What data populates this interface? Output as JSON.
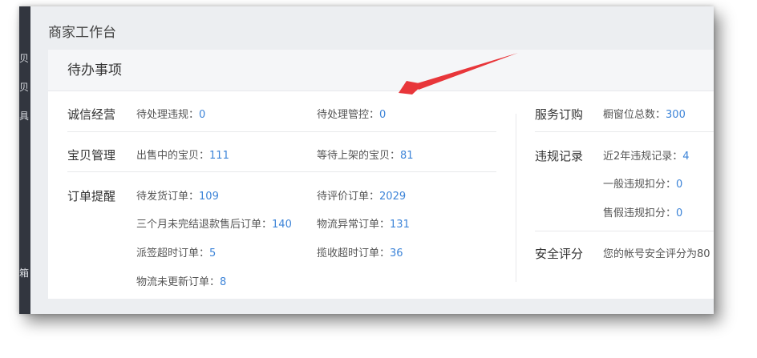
{
  "page_title": "商家工作台",
  "side_fragments": [
    "贝",
    "贝",
    "具",
    "箱"
  ],
  "panel": {
    "title": "待办事项"
  },
  "sep": "：",
  "integrity": {
    "label": "诚信经营",
    "pending_violations": {
      "label": "待处理违规",
      "value": "0"
    },
    "pending_controls": {
      "label": "待处理管控",
      "value": "0"
    }
  },
  "baby": {
    "label": "宝贝管理",
    "on_sale": {
      "label": "出售中的宝贝",
      "value": "111"
    },
    "waiting_listing": {
      "label": "等待上架的宝贝",
      "value": "81"
    }
  },
  "orders": {
    "label": "订单提醒",
    "to_ship": {
      "label": "待发货订单",
      "value": "109"
    },
    "to_review": {
      "label": "待评价订单",
      "value": "2029"
    },
    "refund_after_sale": {
      "label": "三个月未完结退款售后订单",
      "value": "140"
    },
    "logistics_abnormal": {
      "label": "物流异常订单",
      "value": "131"
    },
    "delivery_timeout": {
      "label": "派签超时订单",
      "value": "5"
    },
    "pickup_timeout": {
      "label": "揽收超时订单",
      "value": "36"
    },
    "logistics_not_updated": {
      "label": "物流未更新订单",
      "value": "8"
    }
  },
  "service": {
    "label": "服务订购",
    "showcase_total": {
      "label": "橱窗位总数",
      "value": "300"
    }
  },
  "violation_records": {
    "label": "违规记录",
    "recent_2y": {
      "label": "近2年违规记录",
      "value": "4"
    },
    "general_deduct": {
      "label": "一般违规扣分",
      "value": "0"
    },
    "fake_deduct": {
      "label": "售假违规扣分",
      "value": "0"
    }
  },
  "security": {
    "label": "安全评分",
    "text": "您的帐号安全评分为80"
  },
  "colors": {
    "link": "#3d84d8",
    "arrow": "#e8363a"
  }
}
